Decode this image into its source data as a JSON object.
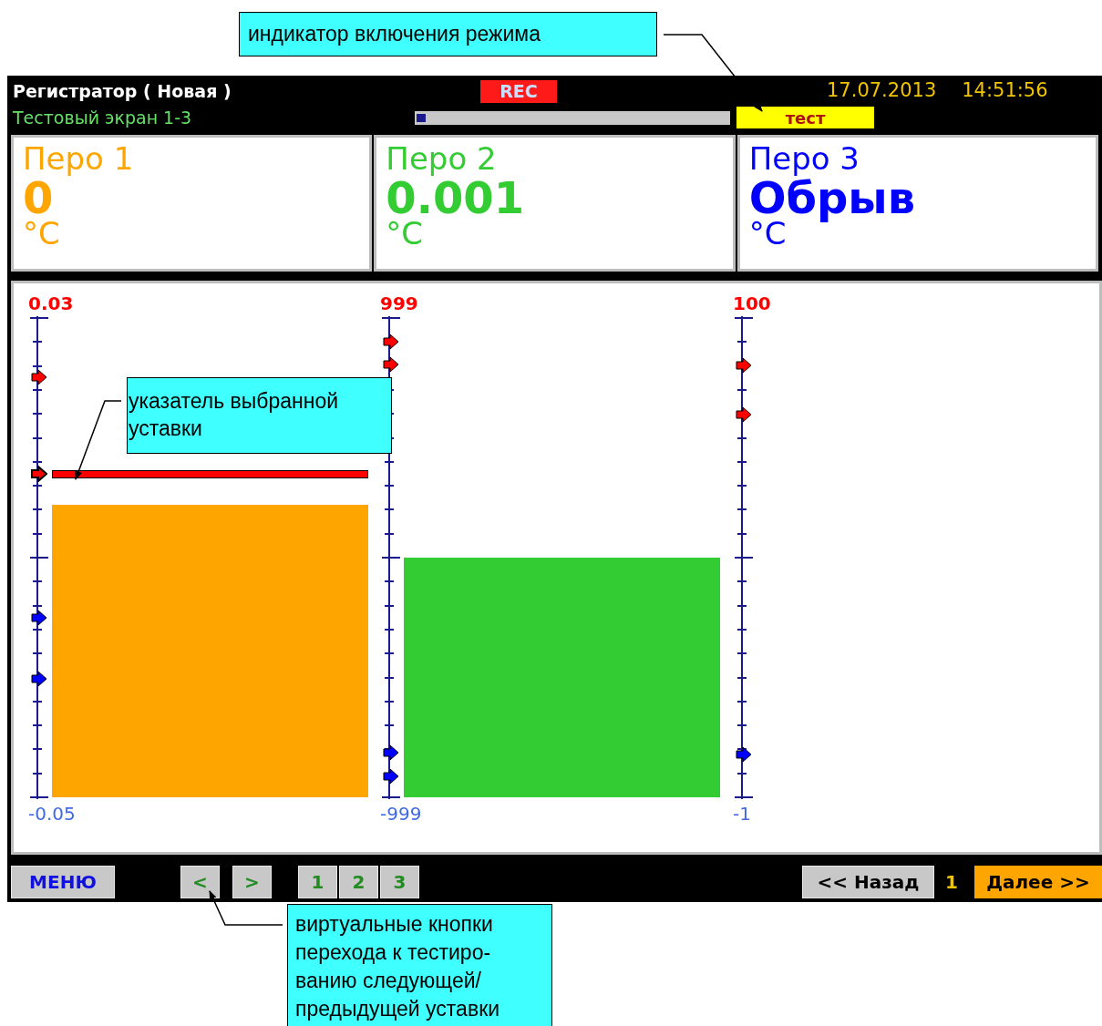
{
  "callouts": [
    {
      "text": "индикатор включения режима"
    },
    {
      "text": " указатель выбранной уставки"
    },
    {
      "text": "виртуальные кнопки перехода к тестиро-ванию следующей/ предыдущей уставки"
    }
  ],
  "header": {
    "title": "Регистратор ( Новая )",
    "subtitle": "Тестовый экран 1-3",
    "rec": "REC",
    "progress": {
      "level": 0.03
    },
    "date": "17.07.2013",
    "time": "14:51:56",
    "mode_badge": "тест"
  },
  "pens": [
    {
      "name": "Перо 1",
      "value": "0",
      "unit": "°C",
      "color": "#ffa500",
      "scale_max": "0.03",
      "scale_min": "-0.05",
      "level": 0.61,
      "setpoints": [
        {
          "kind": "high",
          "level": 0.876,
          "selected": false
        },
        {
          "kind": "high",
          "level": 0.675,
          "selected": true
        },
        {
          "kind": "low",
          "level": 0.374,
          "selected": false
        },
        {
          "kind": "low",
          "level": 0.247,
          "selected": false
        }
      ]
    },
    {
      "name": "Перо 2",
      "value": "0.001",
      "unit": "°C",
      "color": "#33cc33",
      "scale_max": "999",
      "scale_min": "-999",
      "level": 0.5,
      "setpoints": [
        {
          "kind": "high",
          "level": 0.95,
          "selected": false
        },
        {
          "kind": "high",
          "level": 0.903,
          "selected": false
        },
        {
          "kind": "low",
          "level": 0.093,
          "selected": false
        },
        {
          "kind": "low",
          "level": 0.044,
          "selected": false
        }
      ]
    },
    {
      "name": "Перо 3",
      "value": "Обрыв",
      "unit": "°C",
      "color": "#0000ff",
      "scale_max": "100",
      "scale_min": "-1",
      "setpoints": [
        {
          "kind": "high",
          "level": 0.901,
          "selected": false
        },
        {
          "kind": "high",
          "level": 0.799,
          "selected": false
        },
        {
          "kind": "low",
          "level": 0.089,
          "selected": false
        }
      ]
    }
  ],
  "footer": {
    "menu": "МЕНЮ",
    "prev": "<",
    "next": ">",
    "pages": [
      "1",
      "2",
      "3"
    ],
    "back": "<< Назад",
    "page_number": "1",
    "forward": "Далее >>"
  }
}
